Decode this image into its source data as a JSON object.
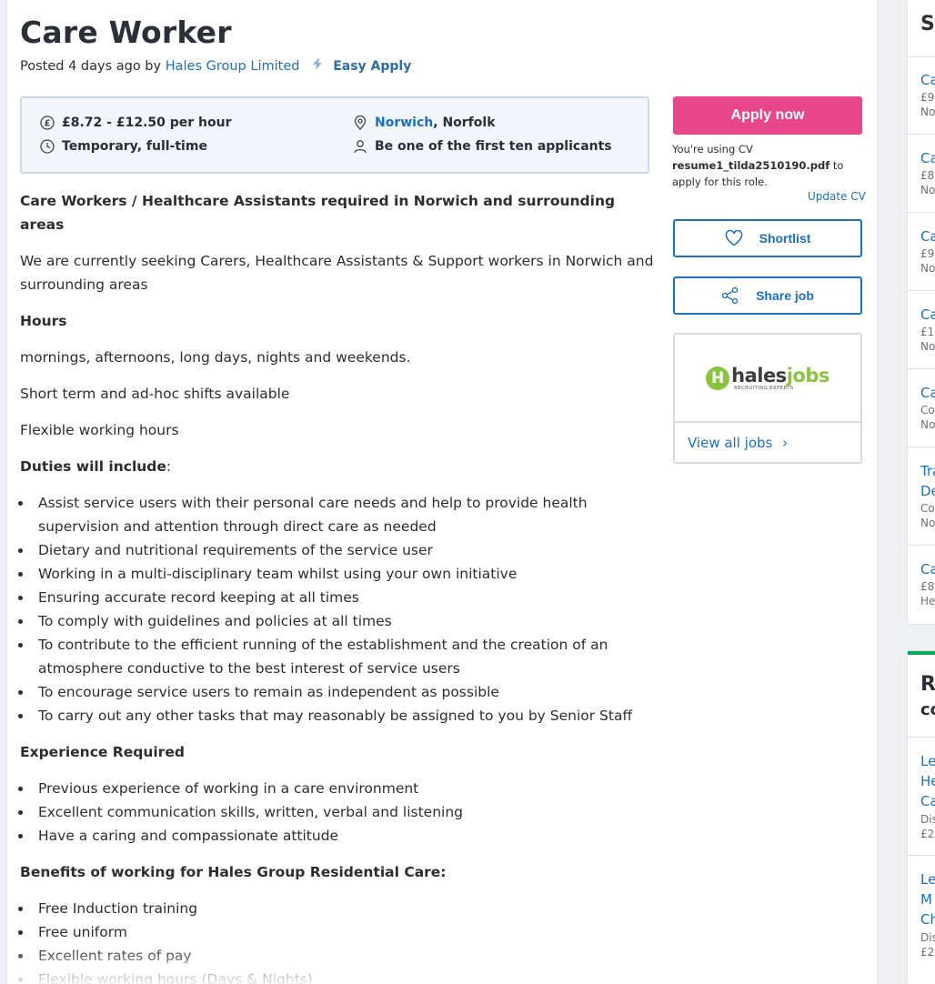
{
  "job": {
    "title": "Care Worker",
    "posted_prefix": "Posted 4 days ago by",
    "company": "Hales Group Limited",
    "easy_apply": "Easy Apply"
  },
  "summary": {
    "salary": "£8.72 - £12.50 per hour",
    "job_type": "Temporary, full-time",
    "location_city": "Norwich",
    "location_region": ", Norfolk",
    "applicants": "Be one of the first ten applicants"
  },
  "description": {
    "heading": "Care Workers / Healthcare Assistants required in Norwich and surrounding areas",
    "intro": "We are currently seeking Carers, Healthcare Assistants & Support workers in Norwich and surrounding areas",
    "hours_heading": "Hours",
    "hours_lines": [
      "mornings, afternoons, long days, nights and weekends.",
      "Short term and ad-hoc shifts available",
      "Flexible working hours"
    ],
    "duties_heading": "Duties will include",
    "duties_colon": ":",
    "duties": [
      "Assist service users with their personal care needs and help to provide health supervision and attention through direct care as needed",
      "Dietary and nutritional requirements of the service user",
      "Working in a multi-disciplinary team whilst using your own initiative",
      "Ensuring accurate record keeping at all times",
      "To comply with guidelines and policies at all times",
      "To contribute to the efficient running of the establishment and the creation of an atmosphere conductive to the best interest of service users",
      "To encourage service users to remain as independent as possible",
      "To carry out any other tasks that may reasonably be assigned to you by Senior Staff"
    ],
    "experience_heading": "Experience Required",
    "experience": [
      "Previous experience of working in a care environment",
      "Excellent communication skills, written, verbal and listening",
      "Have a caring and compassionate attitude"
    ],
    "benefits_heading": "Benefits of working for Hales Group Residential Care:",
    "benefits": [
      "Free Induction training",
      "Free uniform",
      "Excellent rates of pay",
      "Flexible working hours (Days & Nights)"
    ]
  },
  "apply": {
    "button": "Apply now",
    "cv_prefix": "You're using CV",
    "cv_file": "resume1_tilda2510190.pdf",
    "cv_suffix": " to apply for this role.",
    "update_cv": "Update CV"
  },
  "actions": {
    "shortlist": "Shortlist",
    "share": "Share job",
    "shortlist_icon": "heart-icon",
    "share_icon": "share-icon"
  },
  "company_card": {
    "logo_h": "H",
    "logo_part1": "hales",
    "logo_part2": "jobs",
    "logo_tagline": "RECRUITING EXPERTS",
    "view_all": "View all jobs",
    "chevron": "›"
  },
  "similar": {
    "heading": "Si",
    "items": [
      {
        "title": "Ca",
        "line1": "£9",
        "line2": "No"
      },
      {
        "title": "Ca",
        "line1": "£8",
        "line2": "No"
      },
      {
        "title": "Ca",
        "line1": "£9",
        "line2": "No"
      },
      {
        "title": "Ca",
        "line1": "£1",
        "line2": "No"
      },
      {
        "title": "Ca",
        "line1": "Co",
        "line2": "No"
      },
      {
        "title": "Tra",
        "title2": "De",
        "line1": "Co",
        "line2": "No"
      },
      {
        "title": "Ca",
        "line1": "£8",
        "line2": "He"
      }
    ]
  },
  "recommended": {
    "heading1": "R",
    "heading2": "co",
    "items": [
      {
        "l1": "Le",
        "l2": "He",
        "l3": "Ca",
        "s1": "Dis",
        "s2": "£2"
      },
      {
        "l1": "Le",
        "l2": "M",
        "l3": "Ch",
        "s1": "Dis",
        "s2": "£2"
      }
    ]
  },
  "colors": {
    "apply": "#e8478b",
    "link": "#1b6fc2",
    "summary_bg": "#f2f6fb",
    "accent_green": "#00a85a"
  }
}
